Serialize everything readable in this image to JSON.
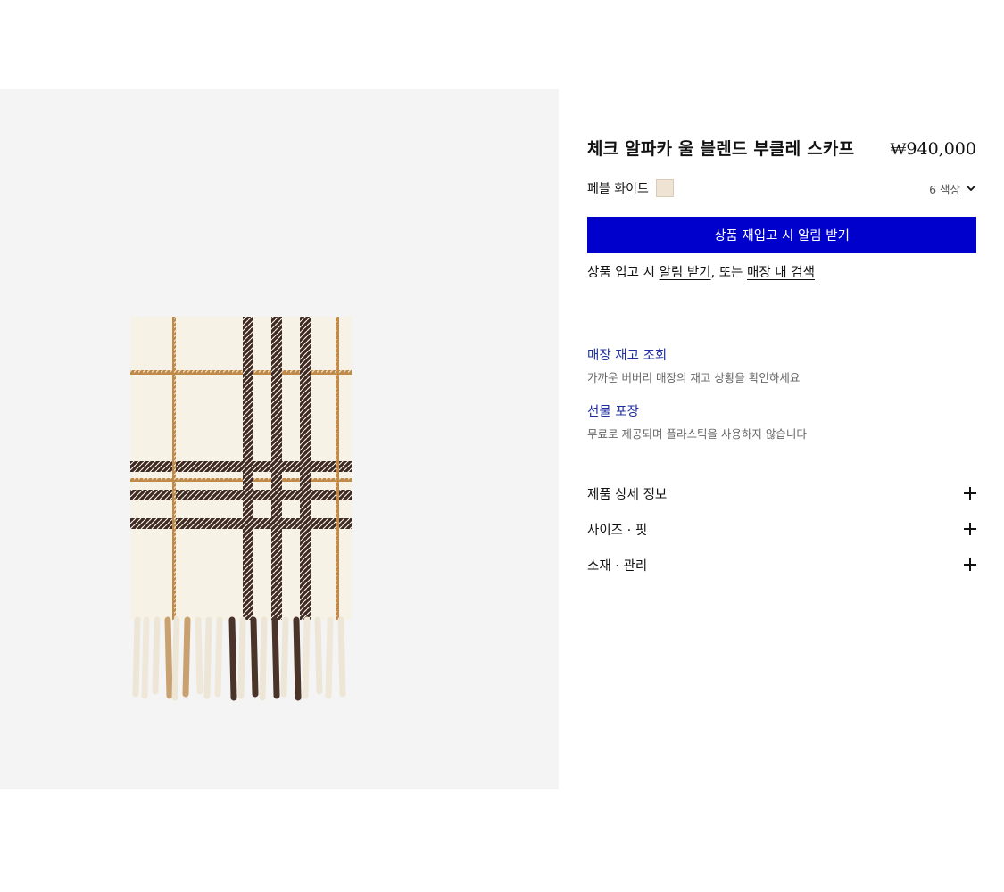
{
  "product": {
    "title": "체크 알파카 울 블렌드 부클레 스카프",
    "price": "₩940,000",
    "image_alt": "scarf-product-image"
  },
  "color": {
    "name": "페블 화이트",
    "swatch_hex": "#efe3d3",
    "count_label": "6 색상"
  },
  "actions": {
    "notify_button": "상품 재입고 시 알림 받기",
    "notify_prefix": "상품 입고 시 ",
    "notify_link": "알림 받기",
    "notify_middle": ", 또는 ",
    "store_link": "매장 내 검색"
  },
  "services": [
    {
      "title": "매장 재고 조회",
      "desc": "가까운 버버리 매장의 재고 상황을 확인하세요"
    },
    {
      "title": "선물 포장",
      "desc": "무료로 제공되며 플라스틱을 사용하지 않습니다"
    }
  ],
  "accordion": [
    {
      "label": "제품 상세 정보",
      "icon": "plus-icon"
    },
    {
      "label": "사이즈 · 핏",
      "icon": "plus-icon"
    },
    {
      "label": "소재 · 관리",
      "icon": "plus-icon"
    }
  ],
  "colors": {
    "accent": "#0000cc",
    "service_link": "#2030a0",
    "media_bg": "#f4f4f4",
    "scarf_base": "#f7f2e6",
    "check_dark": "#3e2a22",
    "check_camel": "#c08a4a"
  }
}
